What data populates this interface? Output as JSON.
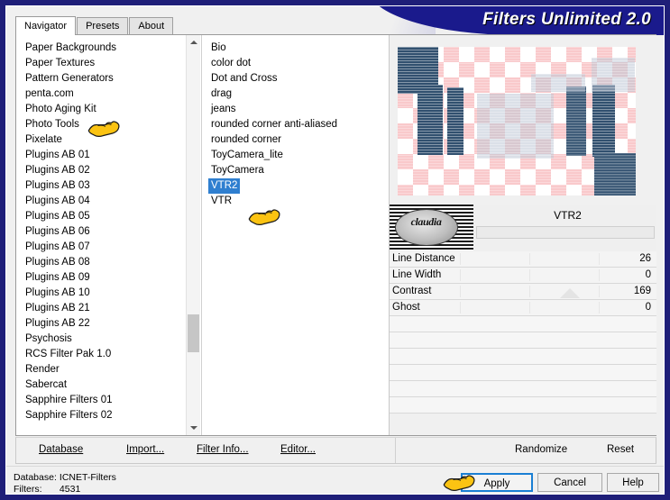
{
  "window": {
    "title": "Filters Unlimited 2.0",
    "accent_banner": "#1a1a8c",
    "frame_color": "#1e1e78"
  },
  "tabs": [
    {
      "label": "Navigator",
      "active": true
    },
    {
      "label": "Presets",
      "active": false
    },
    {
      "label": "About",
      "active": false
    }
  ],
  "categories": {
    "items": [
      "Paper Backgrounds",
      "Paper Textures",
      "Pattern Generators",
      "penta.com",
      "Photo Aging Kit",
      "Photo Tools",
      "Pixelate",
      "Plugins AB 01",
      "Plugins AB 02",
      "Plugins AB 03",
      "Plugins AB 04",
      "Plugins AB 05",
      "Plugins AB 06",
      "Plugins AB 07",
      "Plugins AB 08",
      "Plugins AB 09",
      "Plugins AB 10",
      "Plugins AB 21",
      "Plugins AB 22",
      "Psychosis",
      "RCS Filter Pak 1.0",
      "Render",
      "Sabercat",
      "Sapphire Filters 01",
      "Sapphire Filters 02"
    ],
    "selected": "penta.com"
  },
  "filters": {
    "items": [
      "Bio",
      "color dot",
      "Dot and Cross",
      "drag",
      "jeans",
      "rounded corner anti-aliased",
      "rounded corner",
      "ToyCamera_lite",
      "ToyCamera",
      "VTR2",
      "VTR"
    ],
    "selected": "VTR2"
  },
  "preview": {
    "filter_title": "VTR2",
    "logo_text": "claudia",
    "checker_color": "#f9c9cb",
    "bar_color": "#31506f"
  },
  "parameters": [
    {
      "label": "Line Distance",
      "value": "26",
      "marker": false
    },
    {
      "label": "Line Width",
      "value": "0",
      "marker": false
    },
    {
      "label": "Contrast",
      "value": "169",
      "marker": true
    },
    {
      "label": "Ghost",
      "value": "0",
      "marker": false
    },
    {
      "label": "",
      "value": "",
      "marker": false
    },
    {
      "label": "",
      "value": "",
      "marker": false
    },
    {
      "label": "",
      "value": "",
      "marker": false
    },
    {
      "label": "",
      "value": "",
      "marker": false
    },
    {
      "label": "",
      "value": "",
      "marker": false
    },
    {
      "label": "",
      "value": "",
      "marker": false
    }
  ],
  "actions": {
    "database": "Database",
    "import": "Import...",
    "filter_info": "Filter Info...",
    "editor": "Editor...",
    "randomize": "Randomize",
    "reset": "Reset"
  },
  "status": {
    "database_key": "Database:",
    "database_value": "ICNET-Filters",
    "filters_key": "Filters:",
    "filters_value": "4531"
  },
  "buttons": {
    "apply": "Apply",
    "cancel": "Cancel",
    "help": "Help"
  }
}
